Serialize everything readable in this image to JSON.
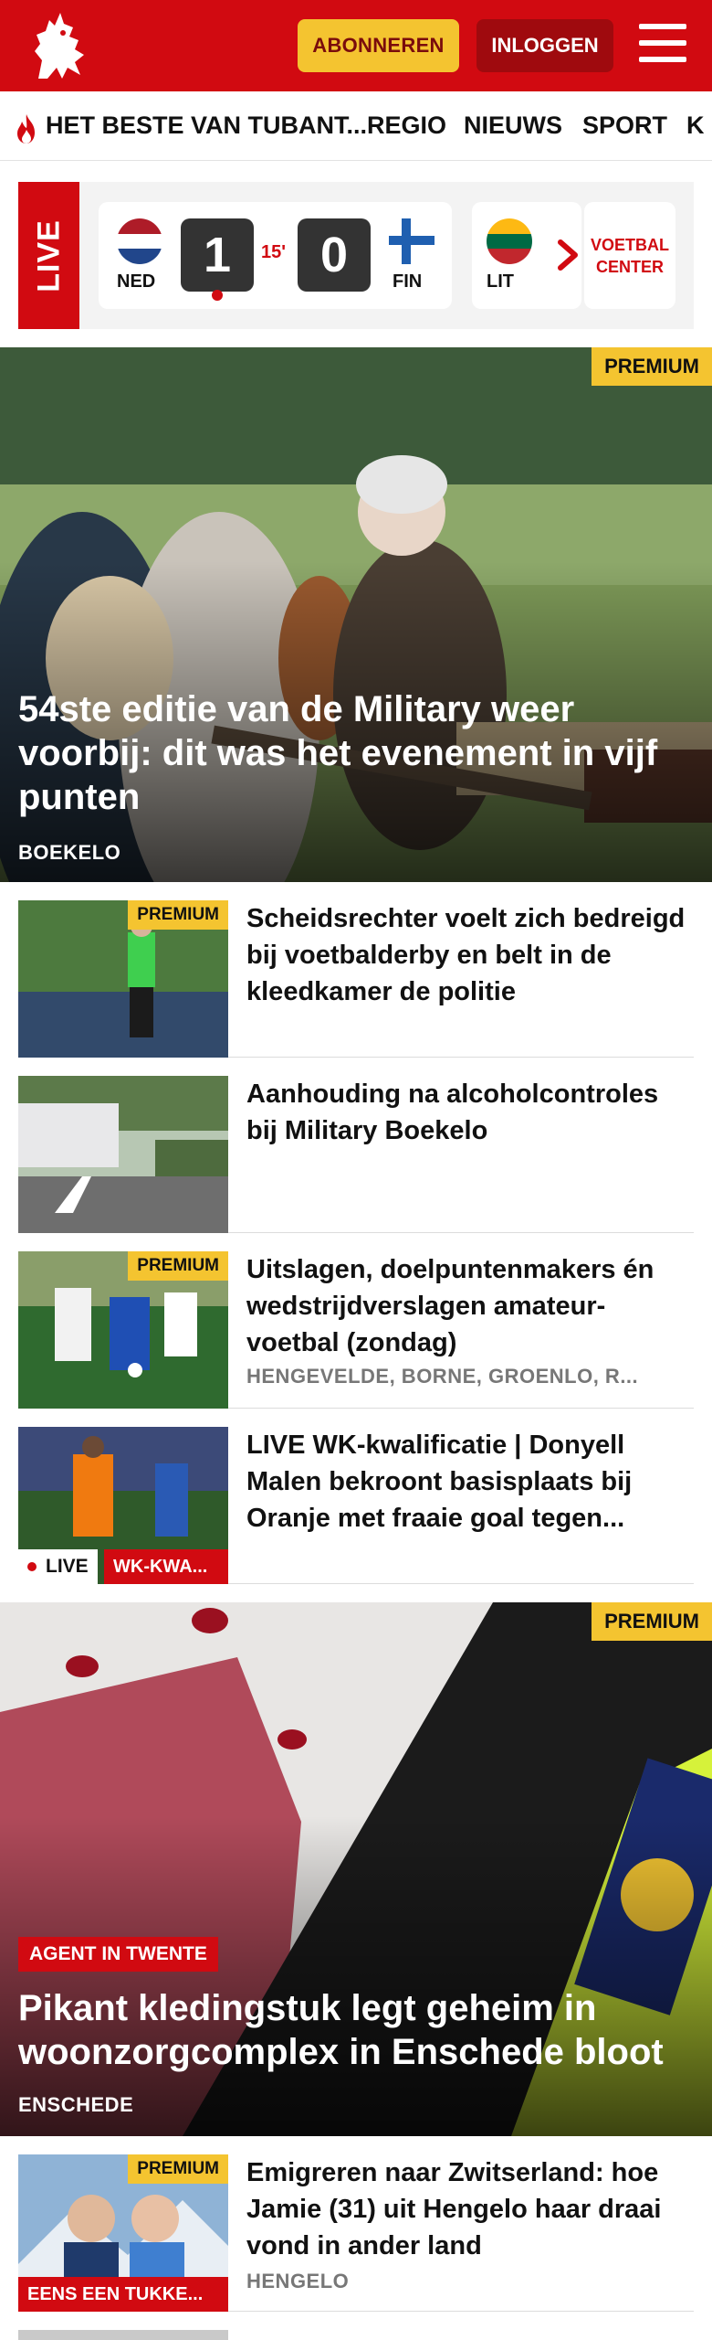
{
  "header": {
    "subscribe_label": "ABONNEREN",
    "login_label": "INLOGGEN",
    "brand_color": "#d10a11",
    "accent_color": "#f4c430"
  },
  "nav": {
    "items": [
      {
        "label": "HET BESTE VAN TUBANT..."
      },
      {
        "label": "REGIO"
      },
      {
        "label": "NIEUWS"
      },
      {
        "label": "SPORT"
      },
      {
        "label": "K"
      }
    ]
  },
  "live_scores": {
    "badge": "LIVE",
    "match": {
      "home_code": "NED",
      "home_score": "1",
      "minute": "15'",
      "away_score": "0",
      "away_code": "FIN"
    },
    "next_match_code": "LIT",
    "voetbal_center_label": "VOETBAL CENTER"
  },
  "hero1": {
    "premium": "PREMIUM",
    "title": "54ste editie van de Military weer voorbij: dit was het evenement in vijf punten",
    "location": "BOEKELO"
  },
  "articles": [
    {
      "premium": "PREMIUM",
      "title": "Scheidsrechter voelt zich bedreigd bij voetbalderby en belt in de kleedkamer de politie"
    },
    {
      "title": "Aanhouding na alcoholcontroles bij Military Boekelo"
    },
    {
      "premium": "PREMIUM",
      "title": "Uitslagen, doelpuntenmakers én wedstrijdverslagen amateur-voetbal (zondag)",
      "location": "HENGEVELDE, BORNE, GROENLO, R..."
    },
    {
      "title": "LIVE WK-kwalificatie | Donyell Malen bekroont basisplaats bij Oranje met fraaie goal tegen...",
      "live": "LIVE",
      "tag": "WK-KWA..."
    }
  ],
  "hero2": {
    "premium": "PREMIUM",
    "tag": "AGENT IN TWENTE",
    "title": "Pikant kledingstuk legt geheim in woonzorgcomplex in Enschede bloot",
    "location": "ENSCHEDE"
  },
  "article5": {
    "premium": "PREMIUM",
    "tag": "EENS EEN TUKKE...",
    "title": "Emigreren naar Zwitserland: hoe Jamie (31) uit Hengelo haar draai vond in ander land",
    "location": "HENGELO"
  }
}
